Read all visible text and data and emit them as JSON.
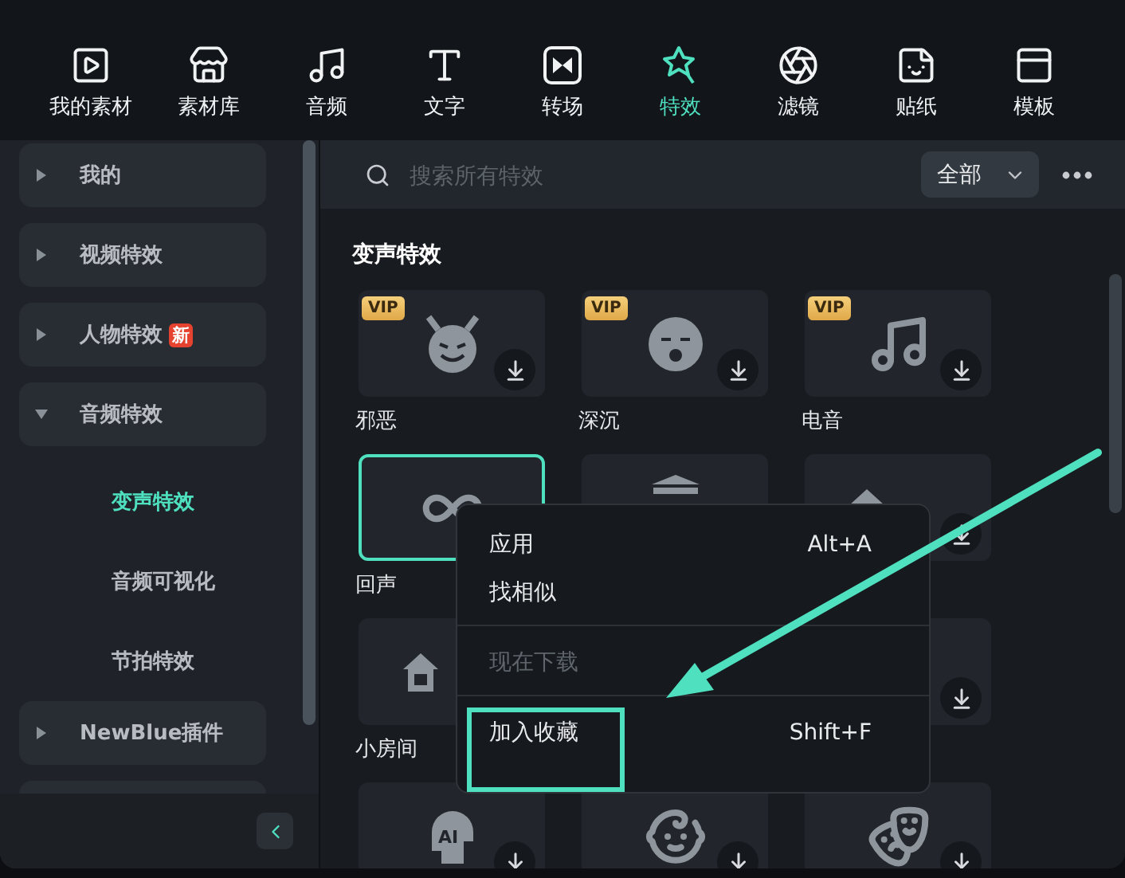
{
  "toolbar": [
    {
      "label": "我的素材",
      "kind": "media",
      "selected": false
    },
    {
      "label": "素材库",
      "kind": "store",
      "selected": false
    },
    {
      "label": "音频",
      "kind": "music",
      "selected": false
    },
    {
      "label": "文字",
      "kind": "text",
      "selected": false
    },
    {
      "label": "转场",
      "kind": "transition",
      "selected": false
    },
    {
      "label": "特效",
      "kind": "effects",
      "selected": true
    },
    {
      "label": "滤镜",
      "kind": "filter",
      "selected": false
    },
    {
      "label": "贴纸",
      "kind": "sticker",
      "selected": false
    },
    {
      "label": "模板",
      "kind": "template",
      "selected": false
    }
  ],
  "sidebar": {
    "items": [
      {
        "label": "我的",
        "expanded": false
      },
      {
        "label": "视频特效",
        "expanded": false
      },
      {
        "label": "人物特效",
        "expanded": false,
        "badge": "新"
      },
      {
        "label": "音频特效",
        "expanded": true,
        "children": [
          {
            "label": "变声特效",
            "selected": true
          },
          {
            "label": "音频可视化",
            "selected": false
          },
          {
            "label": "节拍特效",
            "selected": false
          }
        ]
      },
      {
        "label": "NewBlue插件",
        "expanded": false
      },
      {
        "expanded": false
      }
    ]
  },
  "search": {
    "placeholder": "搜索所有特效"
  },
  "filter": {
    "value": "全部"
  },
  "section": {
    "title": "变声特效"
  },
  "cards": [
    {
      "label": "邪恶",
      "vip": "VIP",
      "kind": "devil",
      "download": true,
      "selected": false
    },
    {
      "label": "深沉",
      "vip": "VIP",
      "kind": "sleepy",
      "download": true,
      "selected": false
    },
    {
      "label": "电音",
      "vip": "VIP",
      "kind": "music",
      "download": true,
      "selected": false
    },
    {
      "label": "回声",
      "kind": "infinity",
      "selected": true
    },
    {
      "kind": "landmark",
      "selected": false
    },
    {
      "kind": "house",
      "download": true,
      "selected": false
    },
    {
      "label": "小房间",
      "kind": "house",
      "selected": false
    },
    {
      "kind": "covered"
    },
    {
      "kind": "covered",
      "download": true,
      "selected": false
    },
    {
      "kind": "ai",
      "icon_text": "AI",
      "download": true,
      "selected": false
    },
    {
      "kind": "baby",
      "download": true,
      "selected": false
    },
    {
      "kind": "mask",
      "download": true,
      "selected": false
    }
  ],
  "context_menu": {
    "items": [
      {
        "label": "应用",
        "shortcut": "Alt+A",
        "disabled": false
      },
      {
        "label": "找相似",
        "disabled": false,
        "divider_after": true
      },
      {
        "label": "现在下载",
        "disabled": true,
        "divider_after": true
      },
      {
        "label": "加入收藏",
        "shortcut": "Shift+F",
        "disabled": false,
        "highlighted": true
      }
    ]
  }
}
